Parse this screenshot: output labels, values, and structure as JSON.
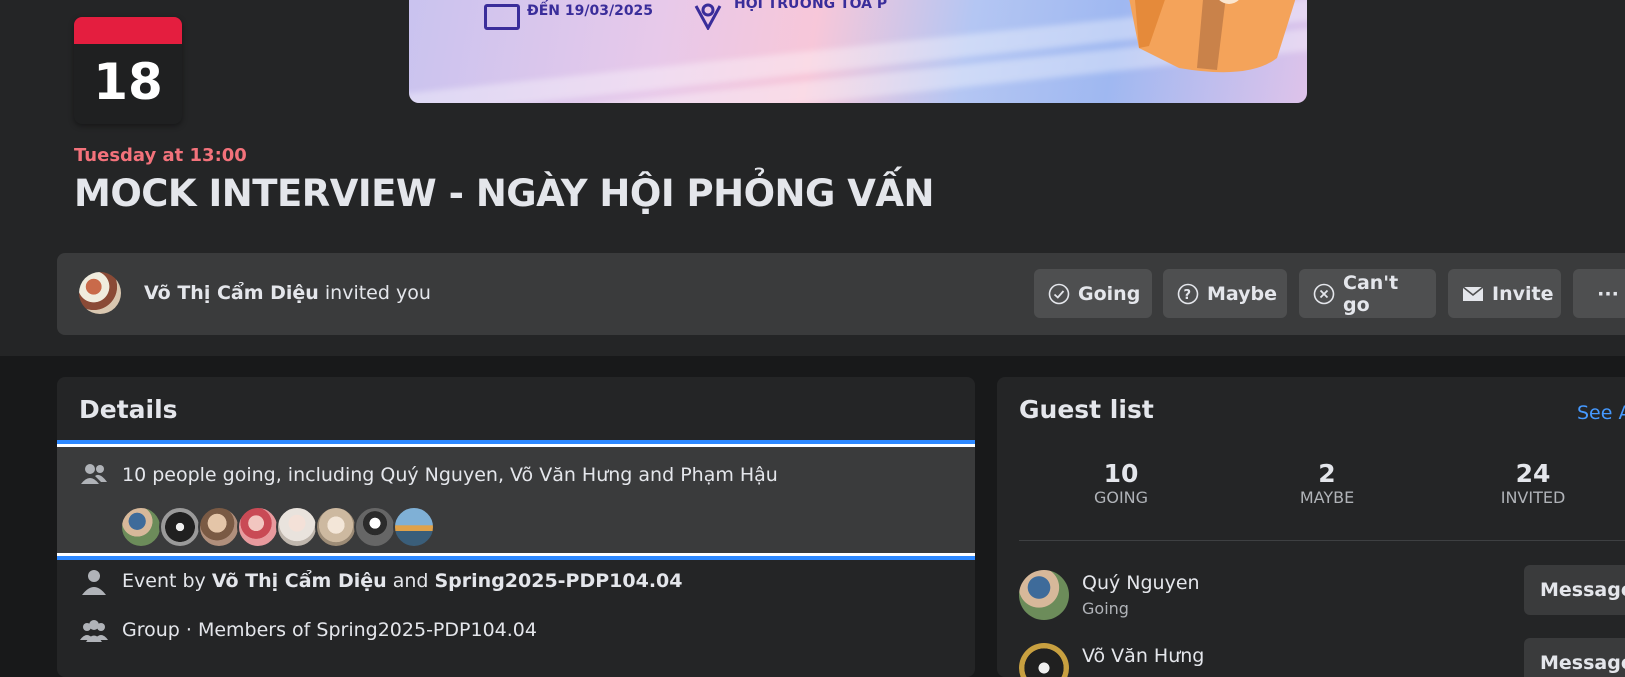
{
  "cover": {
    "date_text": "ĐẾN 19/03/2025",
    "venue_text": "HỘI TRƯỜNG TÒA P",
    "venue_sub": "",
    "box_text": "OF"
  },
  "calendar": {
    "day": "18"
  },
  "event": {
    "time": "Tuesday at 13:00",
    "title": "MOCK INTERVIEW - NGÀY HỘI PHỎNG VẤN"
  },
  "invite": {
    "inviter_name": "Võ Thị Cẩm Diệu",
    "invited_text": "invited you",
    "buttons": [
      {
        "label": "Going",
        "icon": "check-circle-icon"
      },
      {
        "label": "Maybe",
        "icon": "question-circle-icon"
      },
      {
        "label": "Can't go",
        "icon": "x-circle-icon"
      },
      {
        "label": "Invite",
        "icon": "envelope-icon"
      },
      {
        "label": "···",
        "icon": "more-icon"
      }
    ]
  },
  "details": {
    "title": "Details",
    "going_text": "10 people going, including Quý Nguyen, Võ Văn Hưng and Phạm Hậu",
    "event_by_prefix": "Event by",
    "event_by_1": "Võ Thị Cẩm Diệu",
    "event_by_and": "and",
    "event_by_2": "Spring2025-PDP104.04",
    "group_text": "Group · Members of Spring2025-PDP104.04"
  },
  "guests": {
    "title": "Guest list",
    "see_all": "See All",
    "stats": [
      {
        "num": "10",
        "label": "GOING"
      },
      {
        "num": "2",
        "label": "MAYBE"
      },
      {
        "num": "24",
        "label": "INVITED"
      }
    ],
    "list": [
      {
        "name": "Quý Nguyen",
        "status": "Going",
        "action": "Message"
      },
      {
        "name": "Võ Văn Hưng",
        "status": "",
        "action": "Message"
      }
    ]
  },
  "colors": {
    "accent": "#2d88ff",
    "event_time": "#f3727b",
    "calendar_red": "#e41e3f",
    "link": "#4599ff"
  }
}
